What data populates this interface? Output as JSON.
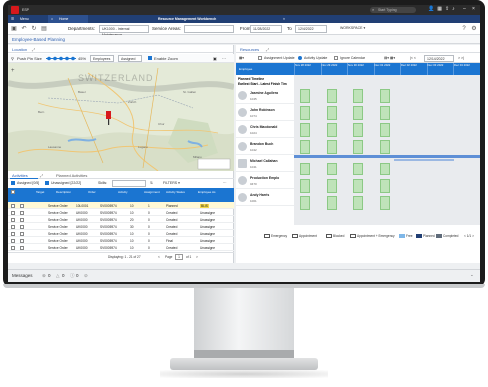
{
  "app": {
    "name": "ESP",
    "search_placeholder": "Start Typing",
    "window_title": "Resource Management Workbench"
  },
  "menubar": {
    "menu": "Menu",
    "home_tab": "Home"
  },
  "toolbar": {
    "departments_label": "Departments:",
    "departments_value": "UK1000 - Internal Maintenance",
    "service_areas_label": "Service Areas:",
    "from_label": "From",
    "from_value": "11/28/2022",
    "to_label": "To",
    "to_value": "12/4/2022",
    "workspace": "WORKSPACE ▾"
  },
  "subheader": "Employee-Based Planning",
  "location": {
    "title": "Location",
    "push_pin_size": "Push Pin Size",
    "zoom": "45%",
    "employees": "Employees",
    "assigned": "Assigned",
    "enable_zoom": "Enable Zoom",
    "map_label": "SWITZERLAND"
  },
  "activities": {
    "tabs": [
      "Activities",
      "Planned Activities"
    ],
    "assigned_count": "Assigned [0/5]",
    "unassigned_count": "Unassigned [22/22]",
    "skills": "Skills:",
    "filters": "FILTERS ▾",
    "columns": [
      "Target",
      "Description",
      "Order",
      "Activity",
      "Assignment",
      "Activity Status",
      "Employee As"
    ],
    "rows": [
      {
        "desc": "Service Order",
        "desc2": "",
        "order": "10L0001",
        "order2": "SV0005974",
        "act": "10",
        "asg": "1",
        "status": "Planned",
        "emp": "BLIS"
      },
      {
        "desc": "Service Order",
        "desc2": "UK0000",
        "order": "SV0005974",
        "order2": "",
        "act": "10",
        "asg": "0",
        "status": "Created",
        "emp": "Unassigne"
      },
      {
        "desc": "Service Order",
        "desc2": "UK0000",
        "order": "SV0005974",
        "order2": "",
        "act": "20",
        "asg": "0",
        "status": "Created",
        "emp": "Unassigne"
      },
      {
        "desc": "Service Order",
        "desc2": "UK0000",
        "order": "SV0005974",
        "order2": "",
        "act": "30",
        "asg": "0",
        "status": "Created",
        "emp": "Unassigne"
      },
      {
        "desc": "Service Order",
        "desc2": "UK0000",
        "order": "SV0005974",
        "order2": "",
        "act": "10",
        "asg": "0",
        "status": "Created",
        "emp": "Unassigne"
      },
      {
        "desc": "Service Order",
        "desc2": "UK0000",
        "order": "SV0005974",
        "order2": "",
        "act": "10",
        "asg": "0",
        "status": "Final",
        "emp": "Unassigne"
      },
      {
        "desc": "Service Order",
        "desc2": "UK0000",
        "order": "SV0005974",
        "order2": "",
        "act": "10",
        "asg": "0",
        "status": "Created",
        "emp": "Unassigne"
      }
    ],
    "footer": "Displaying: 1 - 21 of 27",
    "page_label": "Page",
    "page_value": "1",
    "page_of": "of 1"
  },
  "resources": {
    "title": "Resources",
    "assignment_update": "Assignment Update",
    "activity_update": "Activity Update",
    "ignore_calendar": "Ignore Calendar",
    "date_value": "12/14/2022",
    "dates": [
      "Nov 28 2022",
      "Nov 29 2022",
      "Nov 30 2022",
      "Dec 01 2022",
      "Dec 02 2022",
      "Dec 03 2022",
      "Dec 04 2022"
    ],
    "group_label": "Planned Timeline",
    "group2_label": "Earliest Start - Latest Finish Tim",
    "employees": [
      {
        "name": "Jasmine Aguilera",
        "id": "1045"
      },
      {
        "name": "John Robinson",
        "id": "1074"
      },
      {
        "name": "Chris Macdonald",
        "id": "1024"
      },
      {
        "name": "Brandon Buch",
        "id": "1042"
      },
      {
        "name": "Michael Callahan",
        "id": "1041"
      },
      {
        "name": "Production Emplo",
        "id": "0470"
      },
      {
        "name": "Andy Harris",
        "id": "1001"
      }
    ],
    "legend": [
      "Emergency",
      "Appointment",
      "Blocked",
      "Appointment + Emergency",
      "Free",
      "Planned",
      "Completed"
    ],
    "pager": "< 1/1 >"
  },
  "status": {
    "messages": "Messages",
    "c1": "0",
    "c2": "0",
    "c3": "0"
  }
}
